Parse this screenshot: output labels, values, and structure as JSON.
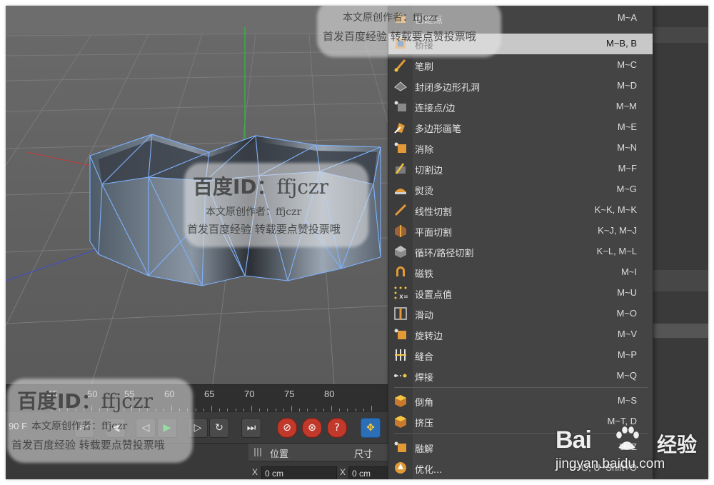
{
  "menu": {
    "items": [
      {
        "label": "创建点",
        "shortcut": "M~A",
        "icon": "create-point-icon"
      },
      {
        "label": "桥接",
        "shortcut": "M~B, B",
        "icon": "bridge-icon",
        "highlighted": true
      },
      {
        "label": "笔刷",
        "shortcut": "M~C",
        "icon": "brush-icon"
      },
      {
        "label": "封闭多边形孔洞",
        "shortcut": "M~D",
        "icon": "close-polygon-hole-icon"
      },
      {
        "label": "连接点/边",
        "shortcut": "M~M",
        "icon": "connect-points-edges-icon"
      },
      {
        "label": "多边形画笔",
        "shortcut": "M~E",
        "icon": "polygon-pen-icon"
      },
      {
        "label": "消除",
        "shortcut": "M~N",
        "icon": "dissolve-icon"
      },
      {
        "label": "切割边",
        "shortcut": "M~F",
        "icon": "edge-cut-icon"
      },
      {
        "label": "熨烫",
        "shortcut": "M~G",
        "icon": "iron-icon"
      },
      {
        "label": "线性切割",
        "shortcut": "K~K, M~K",
        "icon": "line-cut-icon"
      },
      {
        "label": "平面切割",
        "shortcut": "K~J, M~J",
        "icon": "plane-cut-icon"
      },
      {
        "label": "循环/路径切割",
        "shortcut": "K~L, M~L",
        "icon": "loop-path-cut-icon"
      },
      {
        "label": "磁铁",
        "shortcut": "M~I",
        "icon": "magnet-icon"
      },
      {
        "label": "设置点值",
        "shortcut": "M~U",
        "icon": "set-point-value-icon"
      },
      {
        "label": "滑动",
        "shortcut": "M~O",
        "icon": "slide-icon"
      },
      {
        "label": "旋转边",
        "shortcut": "M~V",
        "icon": "spin-edge-icon"
      },
      {
        "label": "缝合",
        "shortcut": "M~P",
        "icon": "stitch-icon"
      },
      {
        "label": "焊接",
        "shortcut": "M~Q",
        "icon": "weld-icon"
      },
      {
        "label": "倒角",
        "shortcut": "M~S",
        "icon": "bevel-icon"
      },
      {
        "label": "挤压",
        "shortcut": "M~T, D",
        "icon": "extrude-icon"
      },
      {
        "label": "融解",
        "shortcut": "U~Z",
        "icon": "melt-icon"
      },
      {
        "label": "优化...",
        "shortcut": "U~O, U~Shift+O",
        "icon": "optimize-icon"
      }
    ]
  },
  "timeline": {
    "ticks": [
      "45",
      "50",
      "55",
      "60",
      "65",
      "70",
      "75",
      "80"
    ],
    "frame_field": "90 F"
  },
  "coords": {
    "position_label": "位置",
    "size_label": "尺寸",
    "x_label": "X",
    "x_pos": "0 cm",
    "x_size": "0 cm"
  },
  "watermarks": {
    "id_text": "百度ID：",
    "id_value": "ffjczr",
    "author_line": "本文原创作者：ffjczr",
    "note_line": "首发百度经验  转载要点赞投票哦"
  },
  "baidu": {
    "brand": "Bai",
    "brand_cn": "经验",
    "url": "jingyan.baidu.com"
  },
  "colors": {
    "accent_blue": "#2d6fb6",
    "highlight": "#c8c8c8",
    "wire": "#7fb2ff"
  }
}
